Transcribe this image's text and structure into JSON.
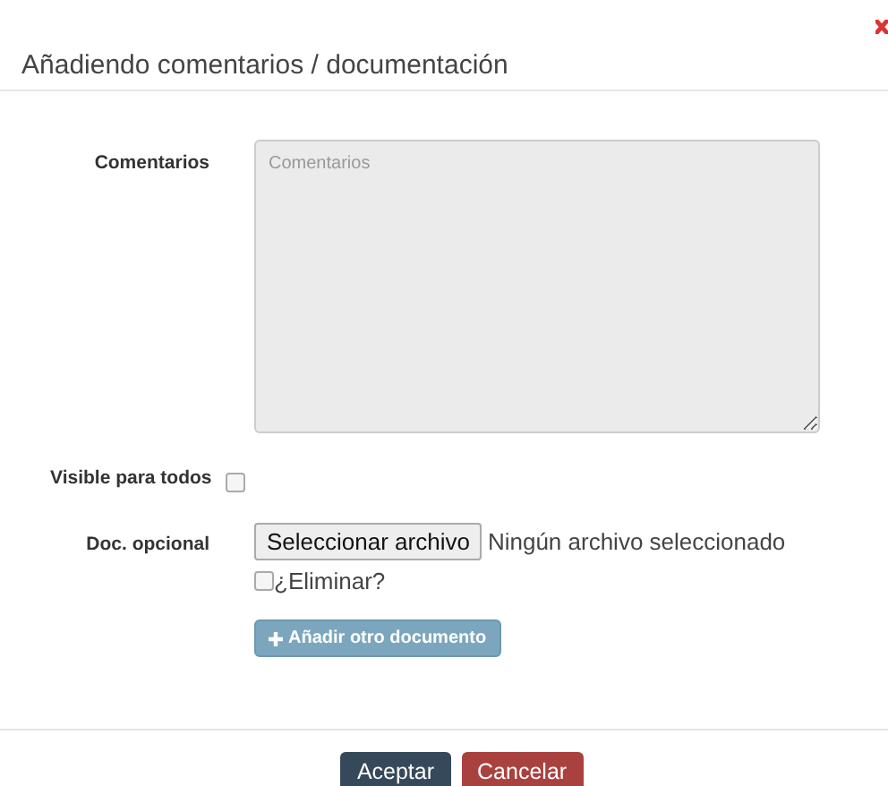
{
  "title": "Añadiendo comentarios / documentación",
  "comments": {
    "label": "Comentarios",
    "placeholder": "Comentarios"
  },
  "visible": {
    "label": "Visible para todos",
    "checked": false
  },
  "document": {
    "label": "Doc. opcional",
    "file_button": "Seleccionar archivo",
    "file_status": "Ningún archivo seleccionado",
    "delete_label": "¿Eliminar?",
    "delete_checked": false
  },
  "add_button": "Añadir otro documento",
  "buttons": [
    {
      "label": "Aceptar",
      "kind": "primary"
    },
    {
      "label": "Cancelar",
      "kind": "danger"
    }
  ]
}
